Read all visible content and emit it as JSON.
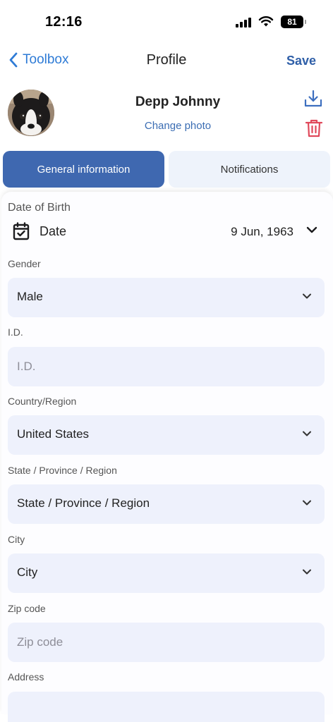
{
  "status": {
    "time": "12:16",
    "battery": "81"
  },
  "nav": {
    "back_label": "Toolbox",
    "title": "Profile",
    "save_label": "Save"
  },
  "profile": {
    "name": "Depp Johnny",
    "change_photo": "Change photo"
  },
  "tabs": {
    "general": "General information",
    "notifications": "Notifications",
    "active": "general"
  },
  "form": {
    "dob_label": "Date of Birth",
    "date_word": "Date",
    "dob_value": "9 Jun, 1963",
    "gender": {
      "label": "Gender",
      "value": "Male"
    },
    "id": {
      "label": "I.D.",
      "placeholder": "I.D."
    },
    "country": {
      "label": "Country/Region",
      "value": "United States"
    },
    "state": {
      "label": "State / Province / Region",
      "value": "State / Province / Region"
    },
    "city": {
      "label": "City",
      "value": "City"
    },
    "zip": {
      "label": "Zip code",
      "placeholder": "Zip code"
    },
    "address": {
      "label": "Address"
    }
  },
  "colors": {
    "accent": "#2e7bd6",
    "primary": "#3f68b0",
    "delete": "#e0485a",
    "field_bg": "#eef1fc"
  },
  "icons": {
    "back": "chevron-left-icon",
    "download": "download-icon",
    "delete": "trash-icon",
    "calendar": "calendar-check-icon",
    "dropdown": "chevron-down-icon"
  }
}
